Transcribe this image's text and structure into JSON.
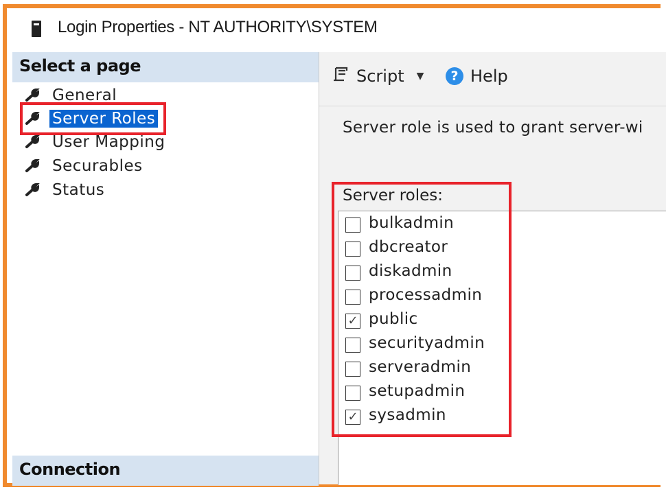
{
  "window": {
    "title": "Login Properties - NT AUTHORITY\\SYSTEM",
    "icon": "server-icon"
  },
  "left_panel": {
    "select_header": "Select a page",
    "pages": [
      {
        "label": "General",
        "icon": "wrench-icon",
        "selected": false
      },
      {
        "label": "Server Roles",
        "icon": "wrench-icon",
        "selected": true
      },
      {
        "label": "User Mapping",
        "icon": "wrench-icon",
        "selected": false
      },
      {
        "label": "Securables",
        "icon": "wrench-icon",
        "selected": false
      },
      {
        "label": "Status",
        "icon": "wrench-icon",
        "selected": false
      }
    ],
    "connection_header": "Connection"
  },
  "toolbar": {
    "script_label": "Script",
    "help_label": "Help"
  },
  "main": {
    "description": "Server role is used to grant server-wi",
    "roles_label": "Server roles:",
    "roles": [
      {
        "name": "bulkadmin",
        "checked": false
      },
      {
        "name": "dbcreator",
        "checked": false
      },
      {
        "name": "diskadmin",
        "checked": false
      },
      {
        "name": "processadmin",
        "checked": false
      },
      {
        "name": "public",
        "checked": true
      },
      {
        "name": "securityadmin",
        "checked": false
      },
      {
        "name": "serveradmin",
        "checked": false
      },
      {
        "name": "setupadmin",
        "checked": false
      },
      {
        "name": "sysadmin",
        "checked": true
      }
    ]
  },
  "colors": {
    "frame_outline": "#f08a2e",
    "highlight_box": "#e8232b",
    "selection": "#0a64d0",
    "section_header_bg": "#d6e3f1",
    "help_icon": "#2d8ee8"
  }
}
